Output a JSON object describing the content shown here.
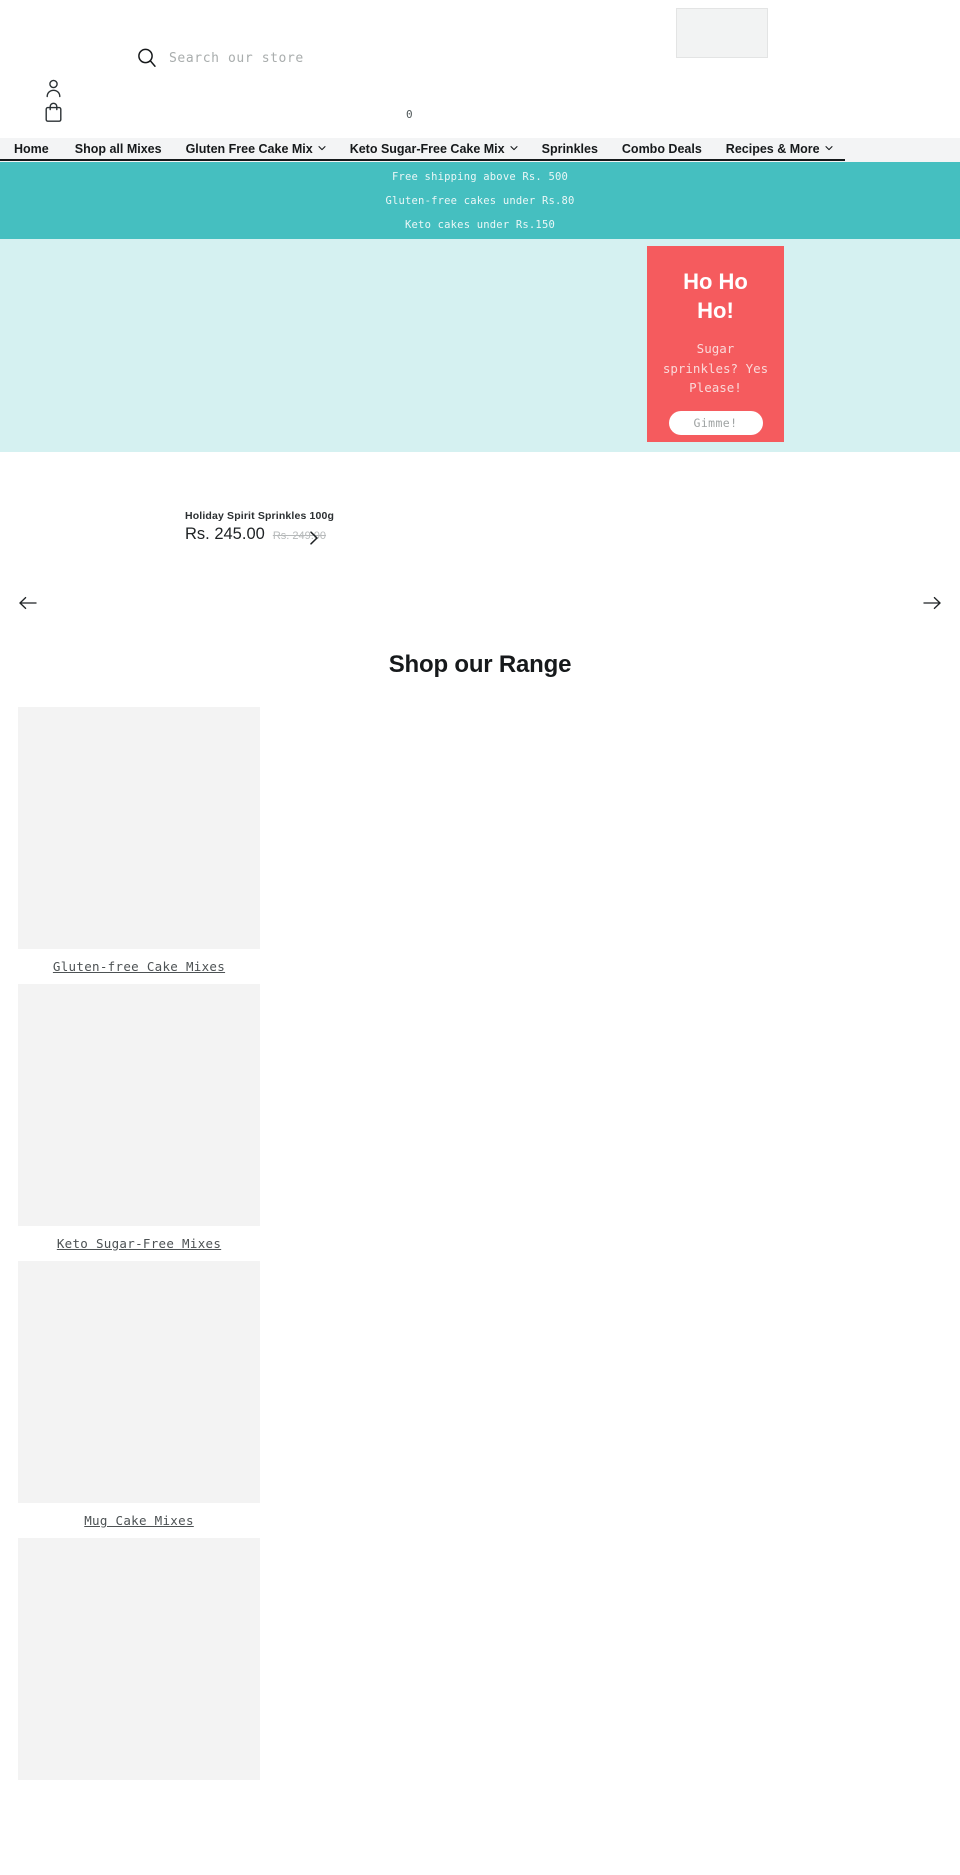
{
  "header": {
    "search": {
      "icon": "search-icon",
      "placeholder": "Search our store",
      "value": ""
    },
    "account_icon": "account-icon",
    "cart_icon": "cart-icon",
    "cart_count": "0",
    "logo_alt": ""
  },
  "nav": {
    "items": [
      {
        "label": "Home",
        "has_dropdown": false
      },
      {
        "label": "Shop all Mixes",
        "has_dropdown": false
      },
      {
        "label": "Gluten Free Cake Mix",
        "has_dropdown": true
      },
      {
        "label": "Keto Sugar-Free Cake Mix",
        "has_dropdown": true
      },
      {
        "label": "Sprinkles",
        "has_dropdown": false
      },
      {
        "label": "Combo Deals",
        "has_dropdown": false
      },
      {
        "label": "Recipes & More",
        "has_dropdown": true
      }
    ]
  },
  "announcement": {
    "background": "#45bfc0",
    "lines": [
      "Free shipping above Rs. 500",
      "Gluten-free cakes under Rs.80",
      "Keto cakes under Rs.150"
    ]
  },
  "hero": {
    "background": "#d5f1f1",
    "promo": {
      "background": "#f55b5e",
      "title": "Ho Ho Ho!",
      "subtitle": "Sugar sprinkles? Yes Please!",
      "button_label": "Gimme!"
    }
  },
  "product": {
    "title": "Holiday Spirit Sprinkles 100g",
    "price": "Rs. 245.00",
    "compare_at_price": "Rs. 249.00",
    "next_icon": "chevron-right-icon"
  },
  "carousel": {
    "prev_icon": "arrow-left-icon",
    "next_icon": "arrow-right-icon"
  },
  "range": {
    "heading": "Shop our Range",
    "collections": [
      {
        "label": "Gluten-free Cake Mixes"
      },
      {
        "label": "Keto Sugar-Free Mixes"
      },
      {
        "label": "Mug Cake Mixes"
      },
      {
        "label": ""
      }
    ]
  }
}
